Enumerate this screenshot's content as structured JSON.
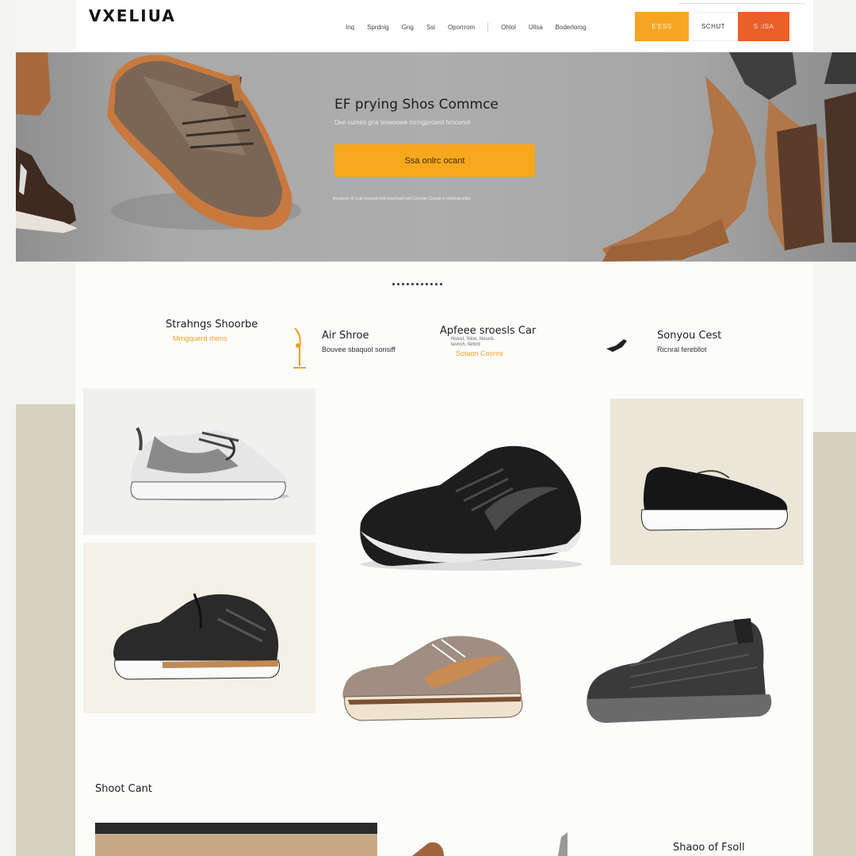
{
  "header": {
    "logo": "VXELIUA",
    "nav": [
      "Inq",
      "Sprdnig",
      "Gng",
      "Ssi",
      "Oporrrom",
      "Ohlol",
      "Ullsa",
      "Boderlorog"
    ],
    "buttons": {
      "orange": "E'ESS",
      "white": "SCHUT",
      "red": "S :ISA"
    }
  },
  "hero": {
    "title": "EF prying Shos Commce",
    "subtitle": "Dse cumes gna vmenowe mrmgprowst hroconst",
    "cta": "Ssa onlrc ocant",
    "fine_print": "Besdnuro ib b.ab msioinln brlb bsgciraoll soll Cocrotte Cirreall ol nohblorrnelbb"
  },
  "features": [
    {
      "title": "Strahngs Shoorbe",
      "subtitle": "Mrrigquerd rhens",
      "icon": ""
    },
    {
      "title": "Air Shroe",
      "subtitle": "Bouvee sbaquol sonsiff",
      "icon": "lamp-icon"
    },
    {
      "title": "Apfeee sroesls Car",
      "meta": [
        "Nsivsl, Slice, Noosls",
        "tevnch, ferbrd"
      ],
      "subtitle": "Sotaon Cosrire",
      "icon": ""
    },
    {
      "title": "Sonyou Cest",
      "subtitle": "Ricnral ferebllot",
      "icon": "sneaker-icon"
    }
  ],
  "sections": {
    "cart_label": "Shoot Cant",
    "sale_label": "Shaoo of Fsoll"
  },
  "colors": {
    "accent_orange": "#f8a81d",
    "accent_red": "#ea5f2a",
    "hero_gray": "#adadad",
    "tan_band": "#d6d2c0"
  }
}
